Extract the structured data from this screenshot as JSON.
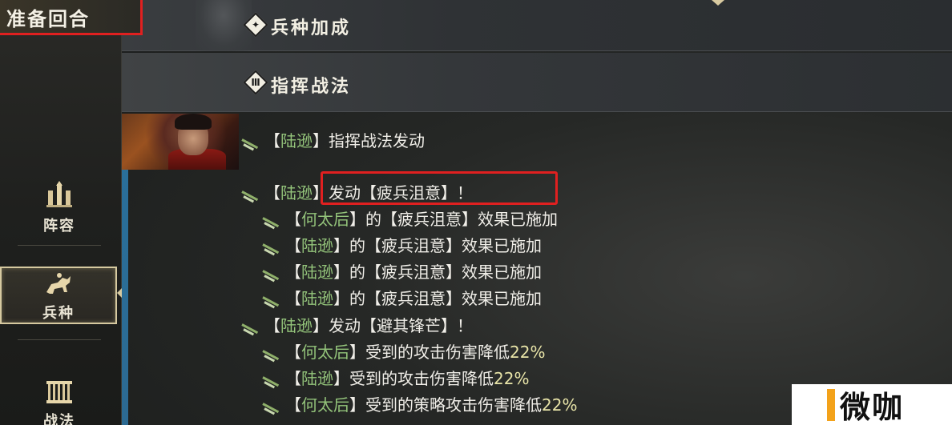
{
  "phase": {
    "title": "准备回合"
  },
  "sidebar": {
    "items": [
      {
        "label": "阵容",
        "icon": "formation-icon"
      },
      {
        "label": "兵种",
        "icon": "cavalry-icon",
        "selected": true
      },
      {
        "label": "战法",
        "icon": "tactics-icon"
      }
    ]
  },
  "sections": [
    {
      "title": "兵种加成",
      "icon": "troop-bonus-icon"
    },
    {
      "title": "指挥战法",
      "icon": "command-tactic-icon"
    }
  ],
  "log": [
    {
      "indent": 0,
      "name": "陆逊",
      "text": "指挥战法发动",
      "pct": ""
    },
    {
      "indent": 0,
      "name": "陆逊",
      "text": "发动【疲兵沮意】！",
      "pct": ""
    },
    {
      "indent": 1,
      "name": "何太后",
      "text": "的【疲兵沮意】效果已施加",
      "pct": ""
    },
    {
      "indent": 1,
      "name": "陆逊",
      "text": "的【疲兵沮意】效果已施加",
      "pct": ""
    },
    {
      "indent": 1,
      "name": "陆逊",
      "text": "的【疲兵沮意】效果已施加",
      "pct": ""
    },
    {
      "indent": 1,
      "name": "陆逊",
      "text": "的【疲兵沮意】效果已施加",
      "pct": ""
    },
    {
      "indent": 0,
      "name": "陆逊",
      "text": "发动【避其锋芒】！",
      "pct": ""
    },
    {
      "indent": 1,
      "name": "何太后",
      "text": "受到的攻击伤害降低",
      "pct": "22%"
    },
    {
      "indent": 1,
      "name": "陆逊",
      "text": "受到的攻击伤害降低",
      "pct": "22%"
    },
    {
      "indent": 1,
      "name": "何太后",
      "text": "受到的策略攻击伤害降低",
      "pct": "22%"
    }
  ],
  "watermark": {
    "text": "微咖"
  },
  "colors": {
    "name": "#93c37a",
    "highlight": "#e02020",
    "accent": "#2a6f9a"
  }
}
